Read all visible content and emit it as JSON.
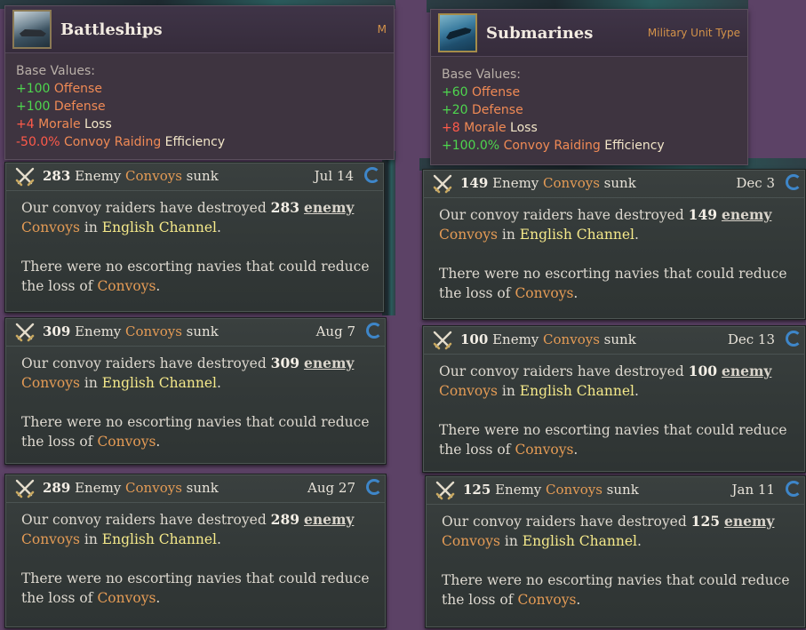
{
  "left": {
    "unit": {
      "title": "Battleships",
      "type_label": "M",
      "base_label": "Base Values:",
      "stats": [
        {
          "value": "+100",
          "name": "Offense",
          "tail": "",
          "sign": "pos"
        },
        {
          "value": "+100",
          "name": "Defense",
          "tail": "",
          "sign": "pos"
        },
        {
          "value": "+4",
          "name": "Morale",
          "tail": " Loss",
          "sign": "neg"
        },
        {
          "value": "-50.0%",
          "name": "Convoy Raiding",
          "tail": " Efficiency",
          "sign": "neg"
        }
      ]
    },
    "events": [
      {
        "count": "283",
        "date": "Jul 14"
      },
      {
        "count": "309",
        "date": "Aug 7"
      },
      {
        "count": "289",
        "date": "Aug 27"
      }
    ]
  },
  "right": {
    "unit": {
      "title": "Submarines",
      "type_label": "Military Unit Type",
      "base_label": "Base Values:",
      "stats": [
        {
          "value": "+60",
          "name": "Offense",
          "tail": "",
          "sign": "pos"
        },
        {
          "value": "+20",
          "name": "Defense",
          "tail": "",
          "sign": "pos"
        },
        {
          "value": "+8",
          "name": "Morale",
          "tail": " Loss",
          "sign": "neg"
        },
        {
          "value": "+100.0%",
          "name": "Convoy Raiding",
          "tail": " Efficiency",
          "sign": "pos"
        }
      ]
    },
    "events": [
      {
        "count": "149",
        "date": "Dec 3"
      },
      {
        "count": "100",
        "date": "Dec 13"
      },
      {
        "count": "125",
        "date": "Jan 11"
      }
    ]
  },
  "event_text": {
    "title_enemy": "Enemy",
    "title_convoys": "Convoys",
    "title_sunk": "sunk",
    "line1_prefix": "Our convoy raiders have destroyed",
    "line1_enemy": "enemy",
    "line1_convoys": "Convoys",
    "line1_in": "in",
    "location": "English Channel",
    "line2": "There were no escorting navies that could reduce the loss of",
    "line2_convoys": "Convoys",
    "period": "."
  },
  "icons": {
    "event": "crossed-swords-icon",
    "status": "loading-spinner-icon"
  },
  "colors": {
    "convoy": "#e49b55",
    "location": "#f5e98a",
    "positive": "#4ed64e",
    "negative": "#ff5a4a",
    "spinner": "#3e86c9"
  }
}
